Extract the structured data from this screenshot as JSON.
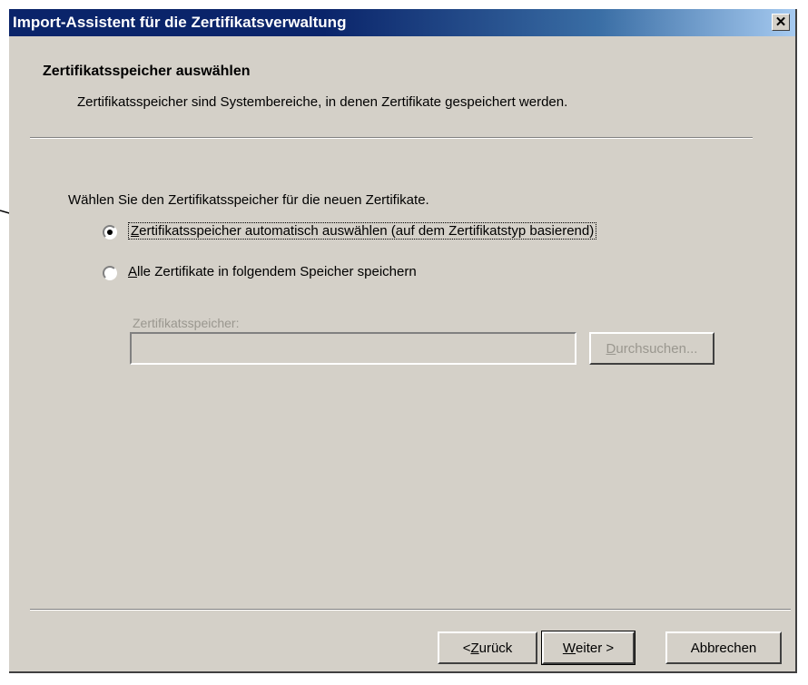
{
  "window": {
    "title": "Import-Assistent für die Zertifikatsverwaltung",
    "close_glyph": "✕"
  },
  "header": {
    "title": "Zertifikatsspeicher auswählen",
    "subtitle": "Zertifikatsspeicher sind Systembereiche, in denen Zertifikate gespeichert werden."
  },
  "content": {
    "prompt": "Wählen Sie den Zertifikatsspeicher für die neuen Zertifikate.",
    "options": [
      {
        "pre": "",
        "mnemonic": "Z",
        "rest": "ertifikatsspeicher automatisch auswählen (auf dem Zertifikatstyp basierend)",
        "selected": true
      },
      {
        "pre": "",
        "mnemonic": "A",
        "rest": "lle Zertifikate in folgendem Speicher speichern",
        "selected": false
      }
    ],
    "store_label": "Zertifikatsspeicher:",
    "store_value": "",
    "browse_button": {
      "pre": "",
      "mnemonic": "D",
      "rest": "urchsuchen..."
    }
  },
  "footer": {
    "back_button": {
      "pre": "< ",
      "mnemonic": "Z",
      "rest": "urück"
    },
    "next_button": {
      "pre": "",
      "mnemonic": "W",
      "rest": "eiter >"
    },
    "cancel_button": "Abbrechen"
  },
  "colors": {
    "face": "#d4d0c8",
    "titlebar_start": "#0a246a",
    "titlebar_end": "#a6caf0",
    "disabled_text": "#9a978f"
  }
}
